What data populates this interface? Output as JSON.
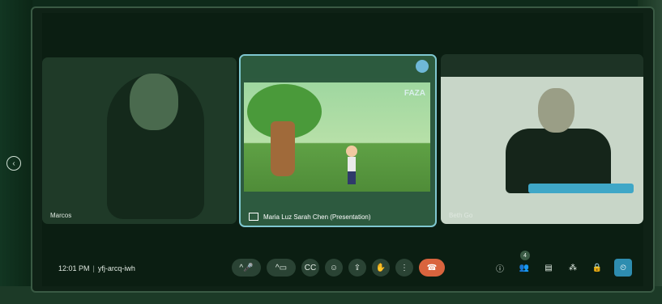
{
  "meeting": {
    "time": "12:01 PM",
    "separator": "|",
    "code": "yfj-arcq-iwh"
  },
  "tiles": {
    "left_camera_label": "Marcos",
    "presentation": {
      "label": "Maria Luz Sarah Chen (Presentation)",
      "brand": "FAZA"
    },
    "right_camera_label": "Beth Go"
  },
  "controls": {
    "mic_chevron": "^",
    "mic_icon": "🎤",
    "cam_chevron": "^",
    "cam_icon": "▭",
    "captions_icon": "CC",
    "emoji_icon": "☺",
    "present_icon": "⇪",
    "raise_hand_icon": "✋",
    "more_icon": "⋮",
    "end_call_icon": "☎"
  },
  "right_icons": {
    "info_icon": "ⓘ",
    "people_icon": "👥",
    "people_count": "4",
    "chat_icon": "▤",
    "activities_icon": "⁂",
    "host_controls_icon": "🔒",
    "clock_icon": "⏲"
  },
  "nav": {
    "left_arrow": "‹"
  },
  "colors": {
    "accent": "#2e8db0",
    "end_call": "#d9643e",
    "presentation_border": "#7fc7d0"
  }
}
